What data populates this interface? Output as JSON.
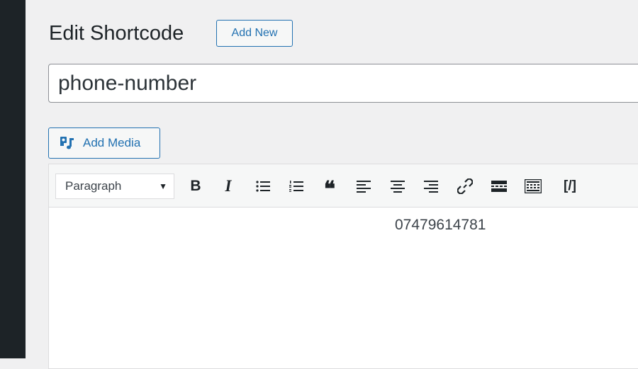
{
  "page": {
    "title": "Edit Shortcode",
    "add_new_label": "Add New"
  },
  "title_field": {
    "value": "phone-number"
  },
  "media": {
    "add_media_label": "Add Media"
  },
  "toolbar": {
    "format_select_value": "Paragraph",
    "buttons": [
      {
        "name": "bold-icon",
        "glyph": "B"
      },
      {
        "name": "italic-icon",
        "glyph": "I"
      },
      {
        "name": "bulleted-list-icon"
      },
      {
        "name": "numbered-list-icon"
      },
      {
        "name": "blockquote-icon",
        "glyph": "❝"
      },
      {
        "name": "align-left-icon"
      },
      {
        "name": "align-center-icon"
      },
      {
        "name": "align-right-icon"
      },
      {
        "name": "insert-link-icon"
      },
      {
        "name": "read-more-icon"
      },
      {
        "name": "toolbar-toggle-icon"
      },
      {
        "name": "shortcode-icon",
        "glyph": "[/]"
      }
    ]
  },
  "editor": {
    "content": "07479614781"
  },
  "colors": {
    "accent": "#2271b1",
    "sidebar": "#1d2327",
    "background": "#f0f0f1"
  }
}
